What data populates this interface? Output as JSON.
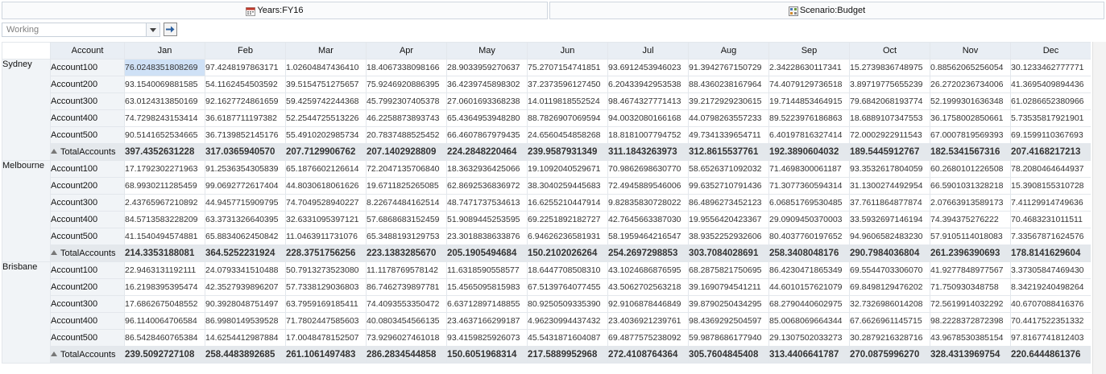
{
  "pov": {
    "years": "Years:FY16",
    "scenario": "Scenario:Budget"
  },
  "version": {
    "value": "Working"
  },
  "grid": {
    "account_header": "Account",
    "months": [
      "Jan",
      "Feb",
      "Mar",
      "Apr",
      "May",
      "Jun",
      "Jul",
      "Aug",
      "Sep",
      "Oct",
      "Nov",
      "Dec"
    ],
    "entities": [
      {
        "name": "Sydney",
        "rows": [
          {
            "label": "Account100",
            "values": [
              "76.0248351808269",
              "97.4248197863171",
              "1.02604847436410",
              "18.4067338098166",
              "28.9033959270637",
              "75.2707154741851",
              "93.6912453946023",
              "91.3942767150729",
              "2.34228630117341",
              "15.2739836748975",
              "0.88562065256054",
              "30.1233462777771"
            ]
          },
          {
            "label": "Account200",
            "values": [
              "93.1540069881585",
              "54.1162454503592",
              "39.5154751275657",
              "75.9246920886395",
              "36.4239745898302",
              "37.2373596127450",
              "6.20433942953538",
              "88.4360238167964",
              "74.4079129736518",
              "3.89719775655239",
              "26.2720236734006",
              "41.3695409894436"
            ]
          },
          {
            "label": "Account300",
            "values": [
              "63.0124313850169",
              "92.1627724861659",
              "59.4259742244368",
              "45.7992307405378",
              "27.0601693368238",
              "14.0119818552524",
              "98.4674327771413",
              "39.2172929230615",
              "19.7144853464915",
              "79.6842068193774",
              "52.1999301636348",
              "61.0286652380966"
            ]
          },
          {
            "label": "Account400",
            "values": [
              "74.7298243153414",
              "36.6187711197382",
              "52.2544725513226",
              "46.2258873893743",
              "65.4364953948280",
              "88.7826907069594",
              "94.0032080166168",
              "44.0798263557233",
              "89.5223976186863",
              "18.6889107347553",
              "36.1758002850661",
              "5.73535817921901"
            ]
          },
          {
            "label": "Account500",
            "values": [
              "90.5141652534665",
              "36.7139852145176",
              "55.4910202985734",
              "20.7837488525452",
              "66.4607867979435",
              "24.6560454858268",
              "18.8181007794752",
              "49.7341339654711",
              "6.40197816327414",
              "72.0002922911543",
              "67.0007819569393",
              "69.1599110367693"
            ]
          }
        ],
        "total": {
          "label": "TotalAccounts",
          "values": [
            "397.4352631228",
            "317.0365940570",
            "207.7129906762",
            "207.1402928809",
            "224.2848220464",
            "239.9587931349",
            "311.1843263973",
            "312.8615537761",
            "192.3890604032",
            "189.5445912767",
            "182.5341567316",
            "207.4168217213"
          ]
        }
      },
      {
        "name": "Melbourne",
        "rows": [
          {
            "label": "Account100",
            "values": [
              "17.1792302271963",
              "91.2536354305839",
              "65.1876602126614",
              "72.2047135706840",
              "18.3632936425066",
              "19.1092040529671",
              "70.9862698630770",
              "58.6526371092032",
              "71.4698300061187",
              "93.3532617804059",
              "60.2680101226508",
              "78.2080464644937"
            ]
          },
          {
            "label": "Account200",
            "values": [
              "68.9930211285459",
              "99.0692772617404",
              "44.8030618061626",
              "19.6711825265085",
              "62.8692536836972",
              "38.3040259445683",
              "72.4945889546006",
              "99.6352710791436",
              "71.3077360594314",
              "31.1300274492954",
              "66.5901031328218",
              "15.3908155310728"
            ]
          },
          {
            "label": "Account300",
            "values": [
              "2.43765967210892",
              "44.9457715909795",
              "74.7049528940227",
              "8.22674484162514",
              "48.7471737534613",
              "16.6255210447914",
              "9.82835830728022",
              "86.4896273452123",
              "6.06851769530485",
              "37.7611864877874",
              "2.07663913589173",
              "7.41129914749636"
            ]
          },
          {
            "label": "Account400",
            "values": [
              "84.5713583228209",
              "63.3731326640395",
              "32.6331095397121",
              "57.6868683152459",
              "51.9089445253595",
              "69.2251892182727",
              "42.7645663387030",
              "19.9556420423367",
              "29.0909450370003",
              "33.5932697146194",
              "74.394375276222",
              "70.4683231011511"
            ]
          },
          {
            "label": "Account500",
            "values": [
              "41.1540494574881",
              "65.8834062450842",
              "11.0463911731076",
              "65.3488193129753",
              "23.3018838633876",
              "6.94626236581931",
              "58.1959464216547",
              "38.9352252932606",
              "80.4037760197652",
              "94.9606582483230",
              "57.9105114018083",
              "7.33567871624576"
            ]
          }
        ],
        "total": {
          "label": "TotalAccounts",
          "values": [
            "214.3353188081",
            "364.5252231924",
            "228.3751756256",
            "223.1383285670",
            "205.1905494684",
            "150.2102026264",
            "254.2697298853",
            "303.7084028691",
            "258.3408048176",
            "290.7984036804",
            "261.2396390693",
            "178.8141629604"
          ]
        }
      },
      {
        "name": "Brisbane",
        "rows": [
          {
            "label": "Account100",
            "values": [
              "22.9463131192111",
              "24.0793341510488",
              "50.7913273523080",
              "11.1178769578142",
              "11.6318590558577",
              "18.6447708508310",
              "43.1024686876595",
              "68.2875821750695",
              "86.4230471865349",
              "69.5544703306070",
              "41.9277848977567",
              "3.37305847469430"
            ]
          },
          {
            "label": "Account200",
            "values": [
              "16.2198395395474",
              "42.3527939896207",
              "57.7338129036803",
              "86.7462739897781",
              "15.4565095815983",
              "67.5139764077455",
              "43.5062702563218",
              "39.1690794541211",
              "44.6010157621079",
              "69.8498129476202",
              "71.750930348758",
              "8.34219240498264"
            ]
          },
          {
            "label": "Account300",
            "values": [
              "17.6862675048552",
              "90.3928048751497",
              "63.7959169185411",
              "74.4093553350472",
              "6.63712897148855",
              "80.9250509335390",
              "92.9106878446849",
              "39.8790250434295",
              "68.2790440602975",
              "32.7326986014208",
              "72.5619914032292",
              "40.6707088416376"
            ]
          },
          {
            "label": "Account400",
            "values": [
              "96.1140064706584",
              "86.9980149539528",
              "71.7802447585603",
              "40.0803454566135",
              "23.4637166299187",
              "4.96230994437432",
              "23.4036921239761",
              "98.4369292504597",
              "85.0068069664344",
              "67.6626961145715",
              "98.2228372872398",
              "70.4417522351332"
            ]
          },
          {
            "label": "Account500",
            "values": [
              "86.5428460765384",
              "14.6254412987884",
              "17.0048478152507",
              "73.9296027461018",
              "93.4159825926073",
              "45.5431871604087",
              "69.4877575238092",
              "59.9878686177940",
              "29.1307502033273",
              "30.2879216328716",
              "43.9678530385154",
              "97.8167741812403"
            ]
          }
        ],
        "total": {
          "label": "TotalAccounts",
          "values": [
            "239.5092727108",
            "258.4483892685",
            "261.1061497483",
            "286.2834544858",
            "150.6051968314",
            "217.5889952968",
            "272.4108764364",
            "305.7604845408",
            "313.4406641787",
            "270.0875996270",
            "328.4313969754",
            "220.6444861376"
          ]
        }
      }
    ],
    "selected_cell": "Sydney.Account100.Jan"
  },
  "colors": {
    "header_bg": "#e9eef4",
    "total_bg": "#e4e8ec",
    "selected_bg": "#cfe1f6",
    "calendar_icon": "#c0392b"
  }
}
